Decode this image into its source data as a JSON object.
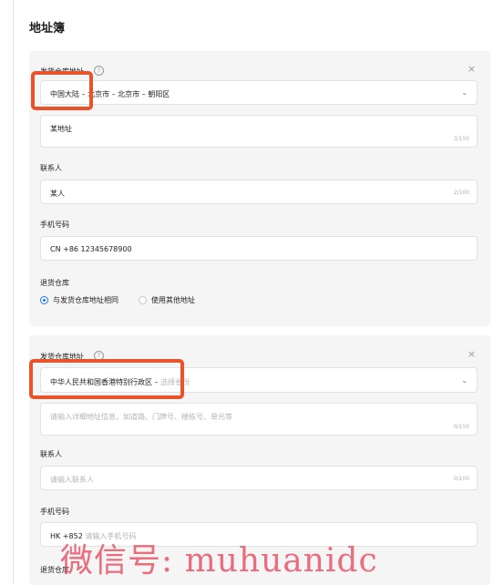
{
  "page_title": "地址簿",
  "address_cards": [
    {
      "warehouse_label": "发货仓库地址",
      "region_value": "中国大陆 – 北京市 – 北京市 – 朝阳区",
      "address_value": "某地址",
      "address_counter": "3/150",
      "contact_label": "联系人",
      "contact_value": "某人",
      "contact_counter": "2/100",
      "phone_label": "手机号码",
      "phone_prefix": "CN +86",
      "phone_value": "12345678900",
      "return_label": "退货仓库",
      "return_option_same": "与发货仓库地址相同",
      "return_option_other": "使用其他地址",
      "return_selected": "same"
    },
    {
      "warehouse_label": "发货仓库地址",
      "region_value": "中华人民共和国香港特别行政区 –",
      "region_placeholder": "选择省份",
      "address_placeholder": "请输入详细地址信息，如道路、门牌号、楼栋号、单元等",
      "address_counter": "0/150",
      "contact_label": "联系人",
      "contact_placeholder": "请输入联系人",
      "contact_counter": "0/100",
      "phone_label": "手机号码",
      "phone_prefix": "HK +852",
      "phone_placeholder": "请输入手机号码",
      "return_label": "退货仓库"
    }
  ],
  "watermark": "微信号: muhuanidc",
  "colors": {
    "accent": "#1677ff",
    "highlight": "#e8532b",
    "card_bg": "#f5f5f6",
    "watermark": "#e6465a"
  },
  "icons": {
    "help": "help-circle-icon",
    "close": "close-icon",
    "chevron": "chevron-down-icon"
  }
}
